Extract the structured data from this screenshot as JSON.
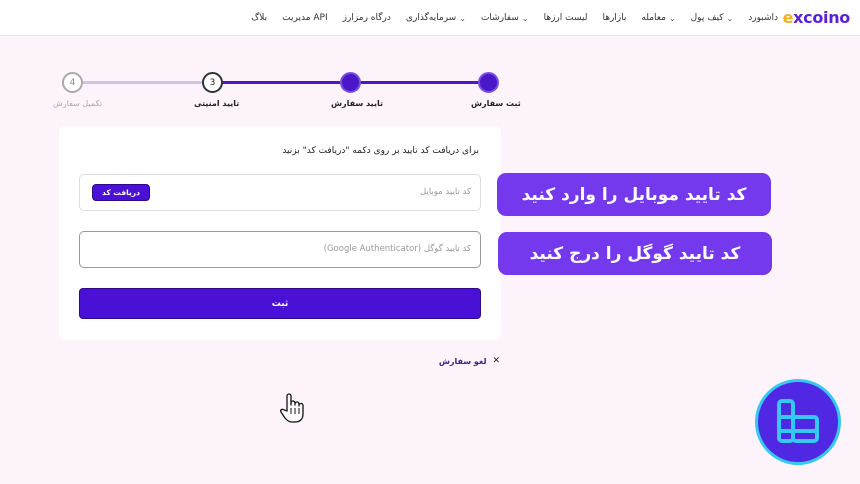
{
  "brand": {
    "logo_first": "e",
    "logo_rest": "xcoino"
  },
  "nav": [
    {
      "label": "داشبورد",
      "dropdown": false
    },
    {
      "label": "کیف پول",
      "dropdown": true
    },
    {
      "label": "معامله",
      "dropdown": true
    },
    {
      "label": "بازارها",
      "dropdown": false
    },
    {
      "label": "لیست ارزها",
      "dropdown": false
    },
    {
      "label": "سفارشات",
      "dropdown": true
    },
    {
      "label": "سرمایه‌گذاری",
      "dropdown": true
    },
    {
      "label": "درگاه رمزارز",
      "dropdown": false
    },
    {
      "label": "مدیریت API",
      "dropdown": false
    },
    {
      "label": "بلاگ",
      "dropdown": false
    }
  ],
  "steps": [
    {
      "label": "ثبت سفارش",
      "number": "",
      "state": "done"
    },
    {
      "label": "تایید سفارش",
      "number": "",
      "state": "done"
    },
    {
      "label": "تایید امنیتی",
      "number": "3",
      "state": "current"
    },
    {
      "label": "تکمیل سفارش",
      "number": "4",
      "state": "pending"
    }
  ],
  "form": {
    "instruction": "برای دریافت کد تایید بر روی دکمه \"دریافت کد\" بزنید",
    "mobile_placeholder": "کد تایید موبایل",
    "get_code_label": "دریافت کد",
    "google_placeholder": "کد تایید گوگل (Google Authenticator)",
    "submit_label": "ثبت"
  },
  "cancel": {
    "label": "لغو سفارش",
    "icon": "close-icon"
  },
  "callouts": {
    "mobile": "کد تایید موبایل را وارد کنید",
    "google": "کد تایید گوگل را درج کنید"
  },
  "colors": {
    "accent": "#4b10d6",
    "callout": "#7439ec",
    "badge": "#5028e3",
    "badge_ring": "#35c8f0",
    "logo_accent": "#f2b01e"
  }
}
